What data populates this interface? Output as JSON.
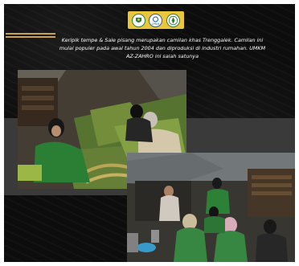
{
  "header": {
    "logos": [
      {
        "icon": "crest-logo-icon"
      },
      {
        "icon": "lpkm-logo-icon",
        "text": "LPKM"
      },
      {
        "icon": "university-seal-icon"
      }
    ]
  },
  "caption": {
    "text": "Keripik tempe & Sale pisang merupakan camilan khas Trenggalek. Camilan ini mulai populer pada awal tahun 2004 dan diproduksi di industri rumahan. UMKM AZ-ZAHRO ini salah satunya"
  },
  "colors": {
    "background": "#0d0d0d",
    "band": "#3a3a3a",
    "accent": "#e9c63b",
    "stripe": "#c9a24a",
    "text": "#ffffff"
  },
  "photos": [
    {
      "icon": "photo-women-sorting-banana-leaves"
    },
    {
      "icon": "photo-group-at-production-site"
    }
  ]
}
